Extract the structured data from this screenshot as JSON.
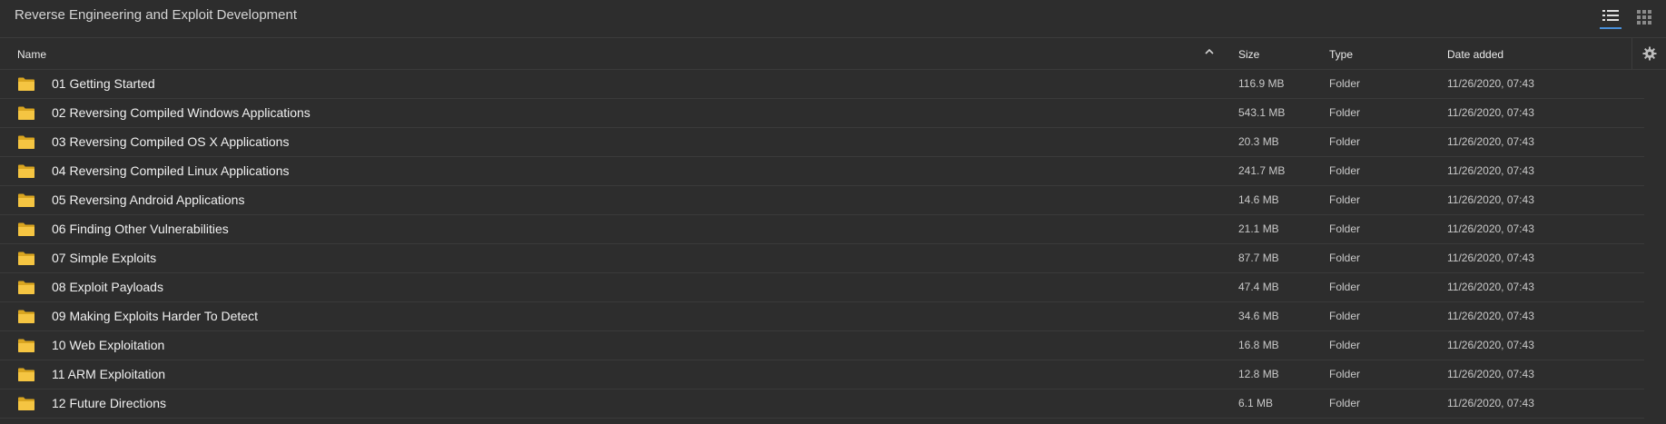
{
  "window": {
    "title": "Reverse Engineering and Exploit Development"
  },
  "view_toggle": {
    "active": "list",
    "accent_color": "#4a90d9"
  },
  "columns": {
    "name": "Name",
    "size": "Size",
    "type": "Type",
    "date": "Date added",
    "sort_icon": "chevron-up-icon",
    "settings_icon": "gear-icon"
  },
  "folder_color": "#f5c542",
  "items": [
    {
      "name": "01 Getting Started",
      "size": "116.9 MB",
      "type": "Folder",
      "date": "11/26/2020, 07:43"
    },
    {
      "name": "02 Reversing Compiled Windows Applications",
      "size": "543.1 MB",
      "type": "Folder",
      "date": "11/26/2020, 07:43"
    },
    {
      "name": "03 Reversing Compiled OS X Applications",
      "size": "20.3 MB",
      "type": "Folder",
      "date": "11/26/2020, 07:43"
    },
    {
      "name": "04 Reversing Compiled Linux Applications",
      "size": "241.7 MB",
      "type": "Folder",
      "date": "11/26/2020, 07:43"
    },
    {
      "name": "05 Reversing Android Applications",
      "size": "14.6 MB",
      "type": "Folder",
      "date": "11/26/2020, 07:43"
    },
    {
      "name": "06 Finding Other Vulnerabilities",
      "size": "21.1 MB",
      "type": "Folder",
      "date": "11/26/2020, 07:43"
    },
    {
      "name": "07 Simple Exploits",
      "size": "87.7 MB",
      "type": "Folder",
      "date": "11/26/2020, 07:43"
    },
    {
      "name": "08 Exploit Payloads",
      "size": "47.4 MB",
      "type": "Folder",
      "date": "11/26/2020, 07:43"
    },
    {
      "name": "09 Making Exploits Harder To Detect",
      "size": "34.6 MB",
      "type": "Folder",
      "date": "11/26/2020, 07:43"
    },
    {
      "name": "10 Web Exploitation",
      "size": "16.8 MB",
      "type": "Folder",
      "date": "11/26/2020, 07:43"
    },
    {
      "name": "11 ARM Exploitation",
      "size": "12.8 MB",
      "type": "Folder",
      "date": "11/26/2020, 07:43"
    },
    {
      "name": "12 Future Directions",
      "size": "6.1 MB",
      "type": "Folder",
      "date": "11/26/2020, 07:43"
    }
  ]
}
